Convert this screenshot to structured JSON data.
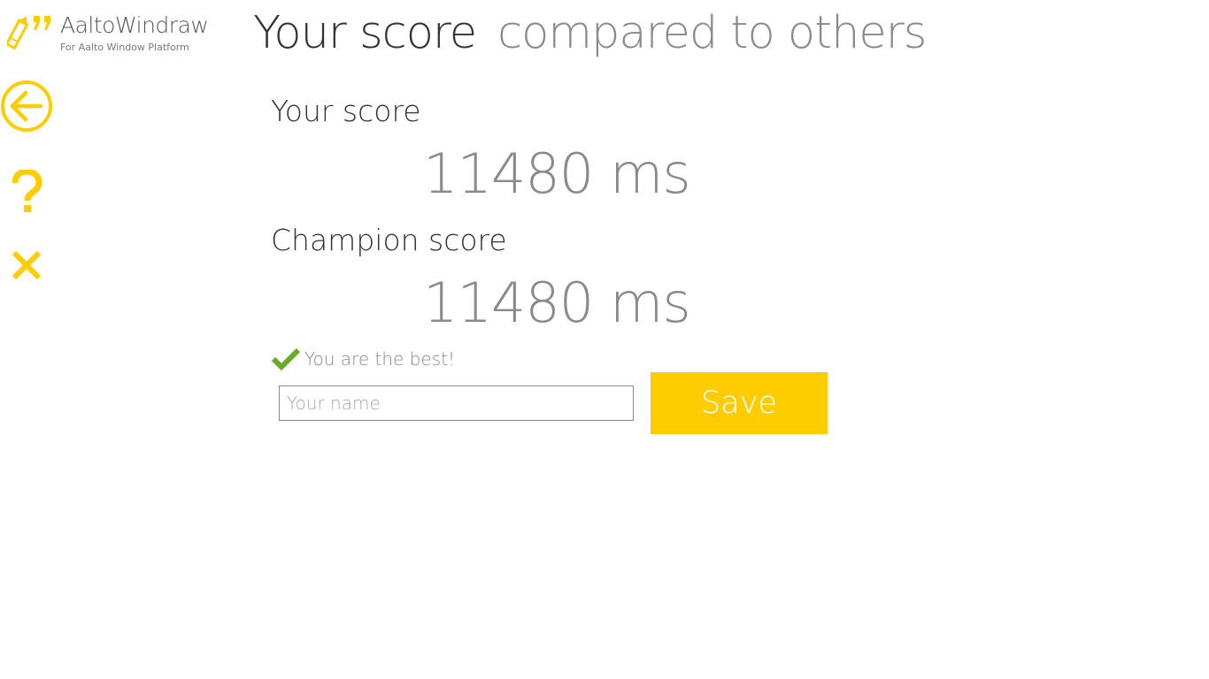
{
  "app": {
    "title": "AaltoWindraw",
    "subtitle": "For Aalto Window Platform",
    "logo_icon": "pencil-quote-icon",
    "accent_color": "#ffcc00"
  },
  "nav": {
    "back_icon": "back-arrow-icon",
    "help_icon": "question-mark-icon",
    "close_icon": "close-icon"
  },
  "header": {
    "title_active": "Your score",
    "title_inactive": "compared to others"
  },
  "scores": {
    "your_label": "Your score",
    "your_value": "11480 ms",
    "champion_label": "Champion score",
    "champion_value": "11480 ms"
  },
  "status": {
    "icon": "checkmark-icon",
    "text": "You are the best!",
    "color": "#6aab2a"
  },
  "form": {
    "name_value": "",
    "name_placeholder": "Your name",
    "save_label": "Save"
  }
}
